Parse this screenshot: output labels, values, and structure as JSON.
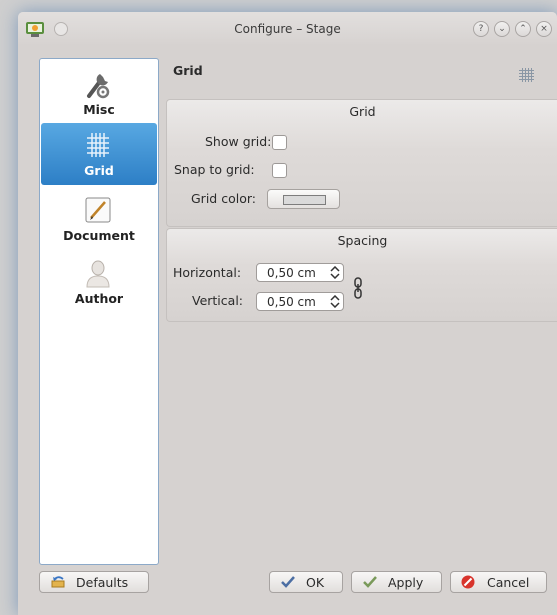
{
  "window": {
    "title": "Configure – Stage"
  },
  "titlebar_buttons": [
    "?",
    "⌄",
    "⌃",
    "×"
  ],
  "sidebar": {
    "items": [
      {
        "label": "Misc",
        "icon": "wrench-icon"
      },
      {
        "label": "Grid",
        "icon": "grid-icon",
        "selected": true
      },
      {
        "label": "Document",
        "icon": "document-icon"
      },
      {
        "label": "Author",
        "icon": "user-icon"
      }
    ]
  },
  "page": {
    "title": "Grid",
    "grid_group": {
      "title": "Grid",
      "show_grid_label": "Show grid:",
      "snap_label": "Snap to grid:",
      "color_label": "Grid color:"
    },
    "spacing_group": {
      "title": "Spacing",
      "horizontal_label": "Horizontal:",
      "horizontal_value": "0,50 cm",
      "vertical_label": "Vertical:",
      "vertical_value": "0,50 cm"
    }
  },
  "buttons": {
    "defaults": "Defaults",
    "ok": "OK",
    "apply": "Apply",
    "cancel": "Cancel"
  },
  "colors": {
    "selection": "#3a8fd5",
    "grid_color": "#dadada"
  }
}
